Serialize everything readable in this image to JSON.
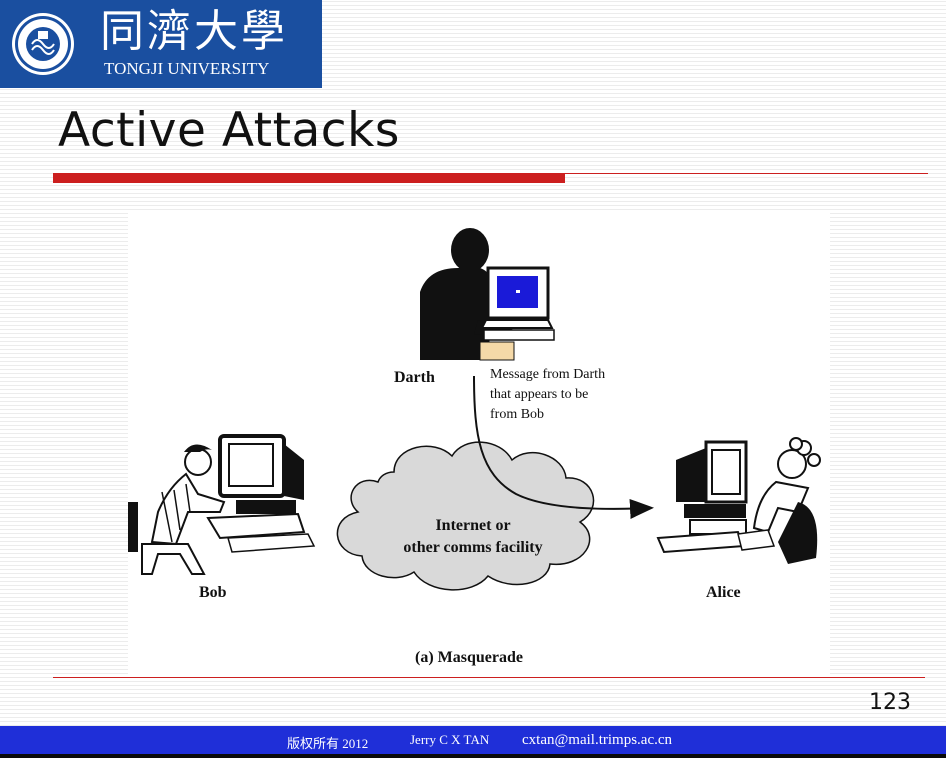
{
  "header": {
    "logo_cn": "同濟大學",
    "logo_en": "TONGJI UNIVERSITY",
    "brand_color": "#1a4fa0"
  },
  "slide": {
    "title": "Active Attacks",
    "accent_color": "#cc1f1f",
    "page_number": "123"
  },
  "figure": {
    "darth_label": "Darth",
    "callout_lines": [
      "Message from Darth",
      "that appears to be",
      "from Bob"
    ],
    "bob_label": "Bob",
    "alice_label": "Alice",
    "cloud_lines": [
      "Internet or",
      "other comms facility"
    ],
    "caption": "(a) Masquerade"
  },
  "footer": {
    "copyright": "版权所有 2012",
    "author": "Jerry C X TAN",
    "email": "cxtan@mail.trimps.ac.cn",
    "color": "#1f2fd8"
  }
}
